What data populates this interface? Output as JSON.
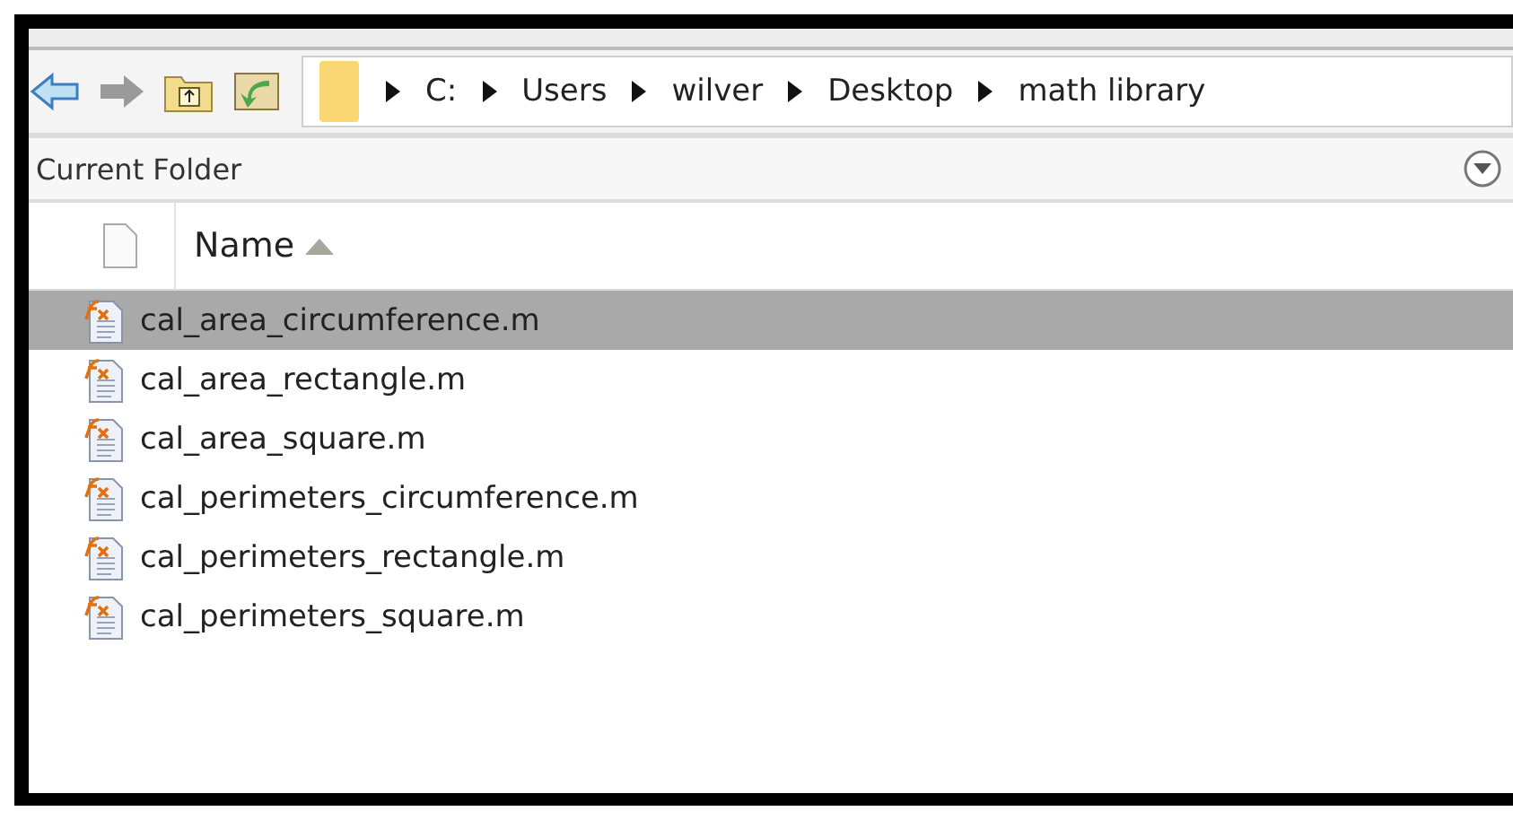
{
  "address_bar": {
    "path": [
      "C:",
      "Users",
      "wilver",
      "Desktop",
      "math library"
    ]
  },
  "panel": {
    "title": "Current Folder"
  },
  "table": {
    "columns": [
      "Name"
    ],
    "rows": [
      {
        "name": "cal_area_circumference.m",
        "selected": true
      },
      {
        "name": "cal_area_rectangle.m",
        "selected": false
      },
      {
        "name": "cal_area_square.m",
        "selected": false
      },
      {
        "name": "cal_perimeters_circumference.m",
        "selected": false
      },
      {
        "name": "cal_perimeters_rectangle.m",
        "selected": false
      },
      {
        "name": "cal_perimeters_square.m",
        "selected": false
      }
    ]
  }
}
